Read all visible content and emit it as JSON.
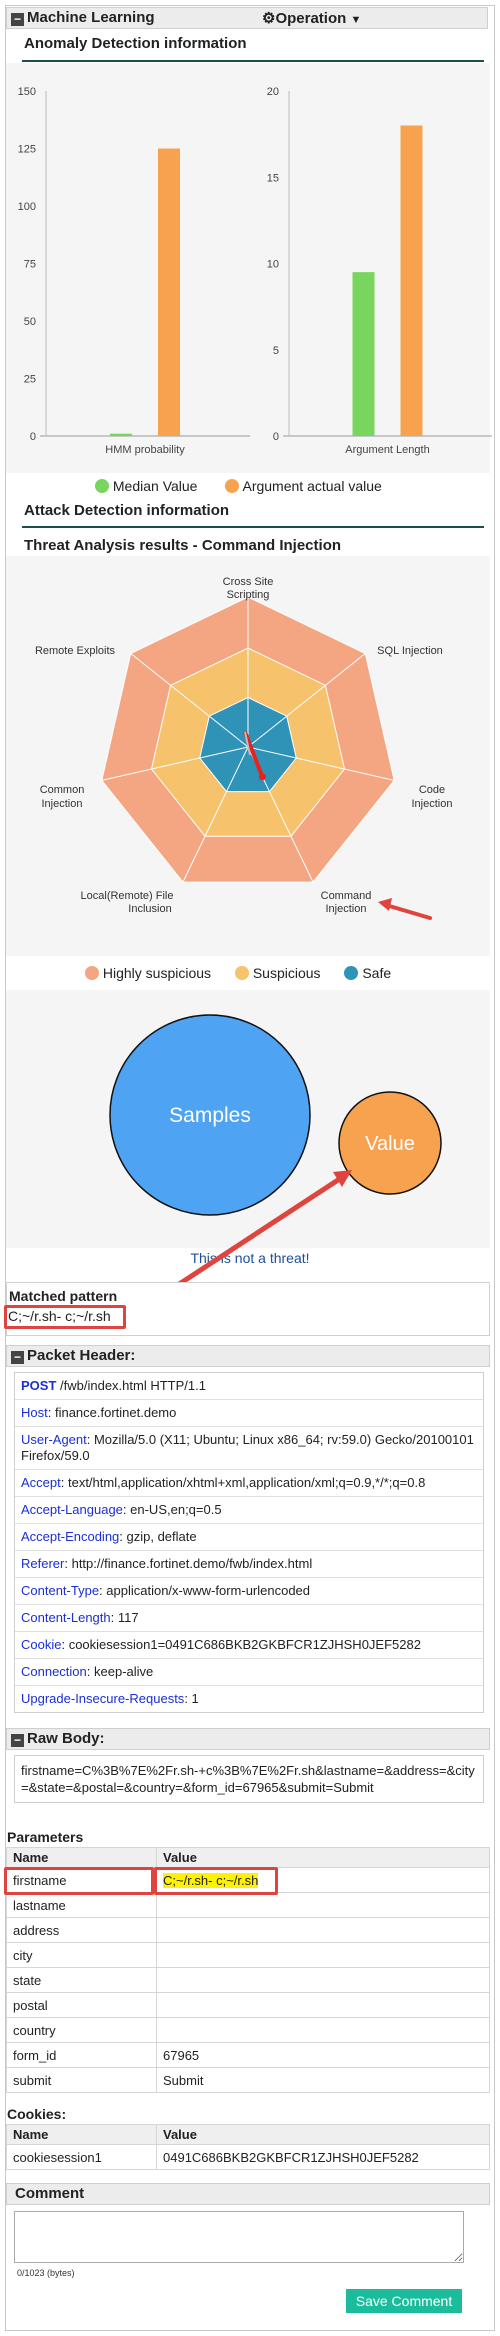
{
  "panel": {
    "title": "Machine Learning",
    "operation_label": "Operation"
  },
  "anomaly": {
    "title": "Anomaly Detection information",
    "legend": {
      "median": "Median Value",
      "actual": "Argument actual value"
    },
    "colors": {
      "median": "#78d65e",
      "actual": "#f7a24f"
    }
  },
  "chart_data": [
    {
      "type": "bar",
      "categories": [
        "HMM probability"
      ],
      "series": [
        {
          "name": "Median Value",
          "values": [
            1
          ]
        },
        {
          "name": "Argument actual value",
          "values": [
            125
          ]
        }
      ],
      "xlabel": "",
      "ylabel": "",
      "yticks": [
        "0",
        "25",
        "50",
        "75",
        "100",
        "125",
        "150"
      ],
      "ylim": [
        0,
        150
      ]
    },
    {
      "type": "bar",
      "categories": [
        "Argument Length"
      ],
      "series": [
        {
          "name": "Median Value",
          "values": [
            9.5
          ]
        },
        {
          "name": "Argument actual value",
          "values": [
            18
          ]
        }
      ],
      "xlabel": "",
      "ylabel": "",
      "yticks": [
        "0",
        "5",
        "10",
        "15",
        "20"
      ],
      "ylim": [
        0,
        20
      ]
    },
    {
      "type": "radar",
      "axes": [
        "Cross Site Scripting",
        "SQL Injection",
        "Code Injection",
        "Command Injection",
        "Local(Remote) File Inclusion",
        "Common Injection",
        "Remote Exploits"
      ],
      "bands": [
        {
          "name": "Highly suspicious",
          "color": "#f4a582",
          "level": 1.0
        },
        {
          "name": "Suspicious",
          "color": "#f6c26b",
          "level": 0.66
        },
        {
          "name": "Safe",
          "color": "#2f93b8",
          "level": 0.33
        }
      ],
      "pointer_axis": "Command Injection",
      "pointer_value": 0.22
    }
  ],
  "attack": {
    "title": "Attack Detection information",
    "threat_title": "Threat Analysis results - Command Injection",
    "radar_labels": {
      "a0_l1": "Cross Site",
      "a0_l2": "Scripting",
      "a1_l1": "SQL Injection",
      "a2_l1": "Code",
      "a2_l2": "Injection",
      "a3_l1": "Command",
      "a3_l2": "Injection",
      "a4_l1": "Local(Remote) File",
      "a4_l2": "Inclusion",
      "a5_l1": "Common",
      "a5_l2": "Injection",
      "a6_l1": "Remote Exploits"
    },
    "legend": {
      "high": "Highly suspicious",
      "susp": "Suspicious",
      "safe": "Safe"
    },
    "bubble_samples": "Samples",
    "bubble_value": "Value",
    "verdict": "This is not a threat!"
  },
  "matched": {
    "title": "Matched pattern",
    "value": "C;~/r.sh- c;~/r.sh"
  },
  "packet": {
    "title": "Packet Header:",
    "rows": [
      {
        "key": "POST",
        "val": " /fwb/index.html HTTP/1.1"
      },
      {
        "key": "Host",
        "val": ": finance.fortinet.demo"
      },
      {
        "key": "User-Agent",
        "val": ": Mozilla/5.0 (X11; Ubuntu; Linux x86_64; rv:59.0) Gecko/20100101 Firefox/59.0"
      },
      {
        "key": "Accept",
        "val": ": text/html,application/xhtml+xml,application/xml;q=0.9,*/*;q=0.8"
      },
      {
        "key": "Accept-Language",
        "val": ": en-US,en;q=0.5"
      },
      {
        "key": "Accept-Encoding",
        "val": ": gzip, deflate"
      },
      {
        "key": "Referer",
        "val": ": http://finance.fortinet.demo/fwb/index.html"
      },
      {
        "key": "Content-Type",
        "val": ": application/x-www-form-urlencoded"
      },
      {
        "key": "Content-Length",
        "val": ": 117"
      },
      {
        "key": "Cookie",
        "val": ": cookiesession1=0491C686BKB2GKBFCR1ZJHSH0JEF5282"
      },
      {
        "key": "Connection",
        "val": ": keep-alive"
      },
      {
        "key": "Upgrade-Insecure-Requests",
        "val": ": 1"
      }
    ]
  },
  "raw": {
    "title": "Raw Body:",
    "text": "firstname=C%3B%7E%2Fr.sh-+c%3B%7E%2Fr.sh&lastname=&address=&city=&state=&postal=&country=&form_id=67965&submit=Submit"
  },
  "params": {
    "title": "Parameters",
    "col_name": "Name",
    "col_value": "Value",
    "rows": [
      {
        "name": "firstname",
        "value": "C;~/r.sh- c;~/r.sh"
      },
      {
        "name": "lastname",
        "value": ""
      },
      {
        "name": "address",
        "value": ""
      },
      {
        "name": "city",
        "value": ""
      },
      {
        "name": "state",
        "value": ""
      },
      {
        "name": "postal",
        "value": ""
      },
      {
        "name": "country",
        "value": ""
      },
      {
        "name": "form_id",
        "value": "67965"
      },
      {
        "name": "submit",
        "value": "Submit"
      }
    ]
  },
  "cookies": {
    "title": "Cookies:",
    "col_name": "Name",
    "col_value": "Value",
    "rows": [
      {
        "name": "cookiesession1",
        "value": "0491C686BKB2GKBFCR1ZJHSH0JEF5282"
      }
    ]
  },
  "comment": {
    "title": "Comment",
    "counter": "0/1023 (bytes)",
    "save_label": "Save Comment"
  }
}
